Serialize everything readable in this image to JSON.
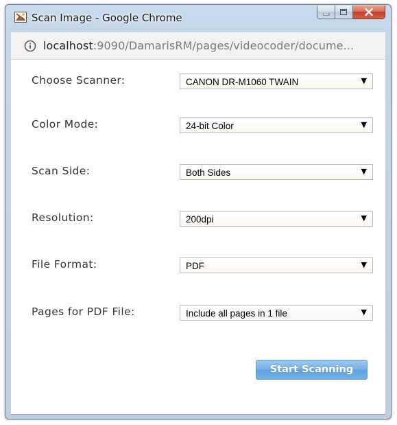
{
  "window": {
    "title": "Scan Image - Google Chrome",
    "controls": {
      "minimize": "minimize",
      "maximize": "maximize",
      "close": "close"
    }
  },
  "urlbar": {
    "host": "localhost",
    "path": ":9090/DamarisRM/pages/videocoder/docume..."
  },
  "form": {
    "scanner": {
      "label": "Choose Scanner:",
      "value": "CANON DR-M1060 TWAIN"
    },
    "color_mode": {
      "label": "Color Mode:",
      "value": "24-bit Color"
    },
    "scan_side": {
      "label": "Scan Side:",
      "value": "Both Sides"
    },
    "resolution": {
      "label": "Resolution:",
      "value": "200dpi"
    },
    "file_format": {
      "label": "File Format:",
      "value": "PDF"
    },
    "pages_for_pdf": {
      "label": "Pages for PDF File:",
      "value": "Include all pages in 1 file"
    }
  },
  "actions": {
    "start_scanning": "Start Scanning"
  },
  "icons": {
    "app": "scanner-app-icon",
    "info": "info-icon",
    "dropdown": "triangle-down-icon"
  },
  "colors": {
    "button_blue": "#74aee4",
    "close_red": "#c4402a",
    "titlebar": "#c4d6ea"
  }
}
